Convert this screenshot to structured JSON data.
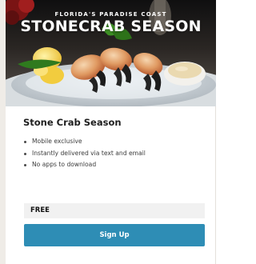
{
  "hero": {
    "eyebrow": "FLORIDA'S PARADISE COAST",
    "headline": "STONECRAB SEASON"
  },
  "offer": {
    "title": "Stone Crab Season",
    "features": [
      "Mobile exclusive",
      "Instantly delivered via text and email",
      "No apps to download"
    ],
    "price": "FREE",
    "cta_label": "Sign Up"
  },
  "colors": {
    "cta_background": "#2e8db5",
    "price_background": "#f1f1f1",
    "page_background": "#efece7"
  }
}
